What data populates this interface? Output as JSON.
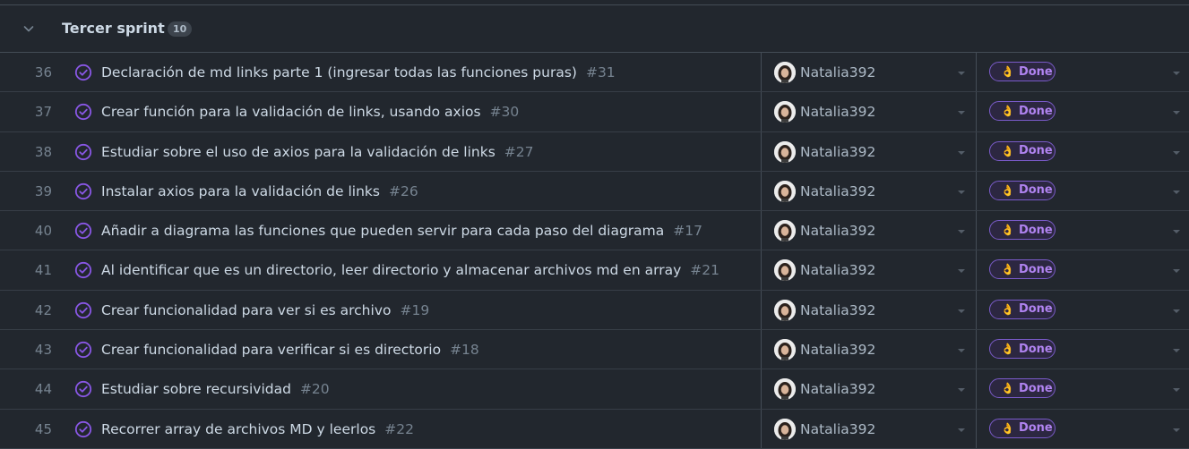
{
  "group": {
    "title": "Tercer sprint",
    "count": "10"
  },
  "colors": {
    "status_done": "#8957e5",
    "badge_text": "#b083f0"
  },
  "rows": [
    {
      "num": "36",
      "title": "Declaración de md links parte 1 (ingresar todas las funciones puras)",
      "issue": "#31",
      "assignee": "Natalia392",
      "status": "Done",
      "status_emoji": "👌"
    },
    {
      "num": "37",
      "title": "Crear función para la validación de links, usando axios",
      "issue": "#30",
      "assignee": "Natalia392",
      "status": "Done",
      "status_emoji": "👌"
    },
    {
      "num": "38",
      "title": "Estudiar sobre el uso de axios para la validación de links",
      "issue": "#27",
      "assignee": "Natalia392",
      "status": "Done",
      "status_emoji": "👌"
    },
    {
      "num": "39",
      "title": "Instalar axios para la validación de links",
      "issue": "#26",
      "assignee": "Natalia392",
      "status": "Done",
      "status_emoji": "👌"
    },
    {
      "num": "40",
      "title": "Añadir a diagrama las funciones que pueden servir para cada paso del diagrama",
      "issue": "#17",
      "assignee": "Natalia392",
      "status": "Done",
      "status_emoji": "👌"
    },
    {
      "num": "41",
      "title": "Al identificar que es un directorio, leer directorio y almacenar archivos md en array",
      "issue": "#21",
      "assignee": "Natalia392",
      "status": "Done",
      "status_emoji": "👌"
    },
    {
      "num": "42",
      "title": "Crear funcionalidad para ver si es archivo",
      "issue": "#19",
      "assignee": "Natalia392",
      "status": "Done",
      "status_emoji": "👌"
    },
    {
      "num": "43",
      "title": "Crear funcionalidad para verificar si es directorio",
      "issue": "#18",
      "assignee": "Natalia392",
      "status": "Done",
      "status_emoji": "👌"
    },
    {
      "num": "44",
      "title": "Estudiar sobre recursividad",
      "issue": "#20",
      "assignee": "Natalia392",
      "status": "Done",
      "status_emoji": "👌"
    },
    {
      "num": "45",
      "title": "Recorrer array de archivos MD y leerlos",
      "issue": "#22",
      "assignee": "Natalia392",
      "status": "Done",
      "status_emoji": "👌"
    }
  ]
}
